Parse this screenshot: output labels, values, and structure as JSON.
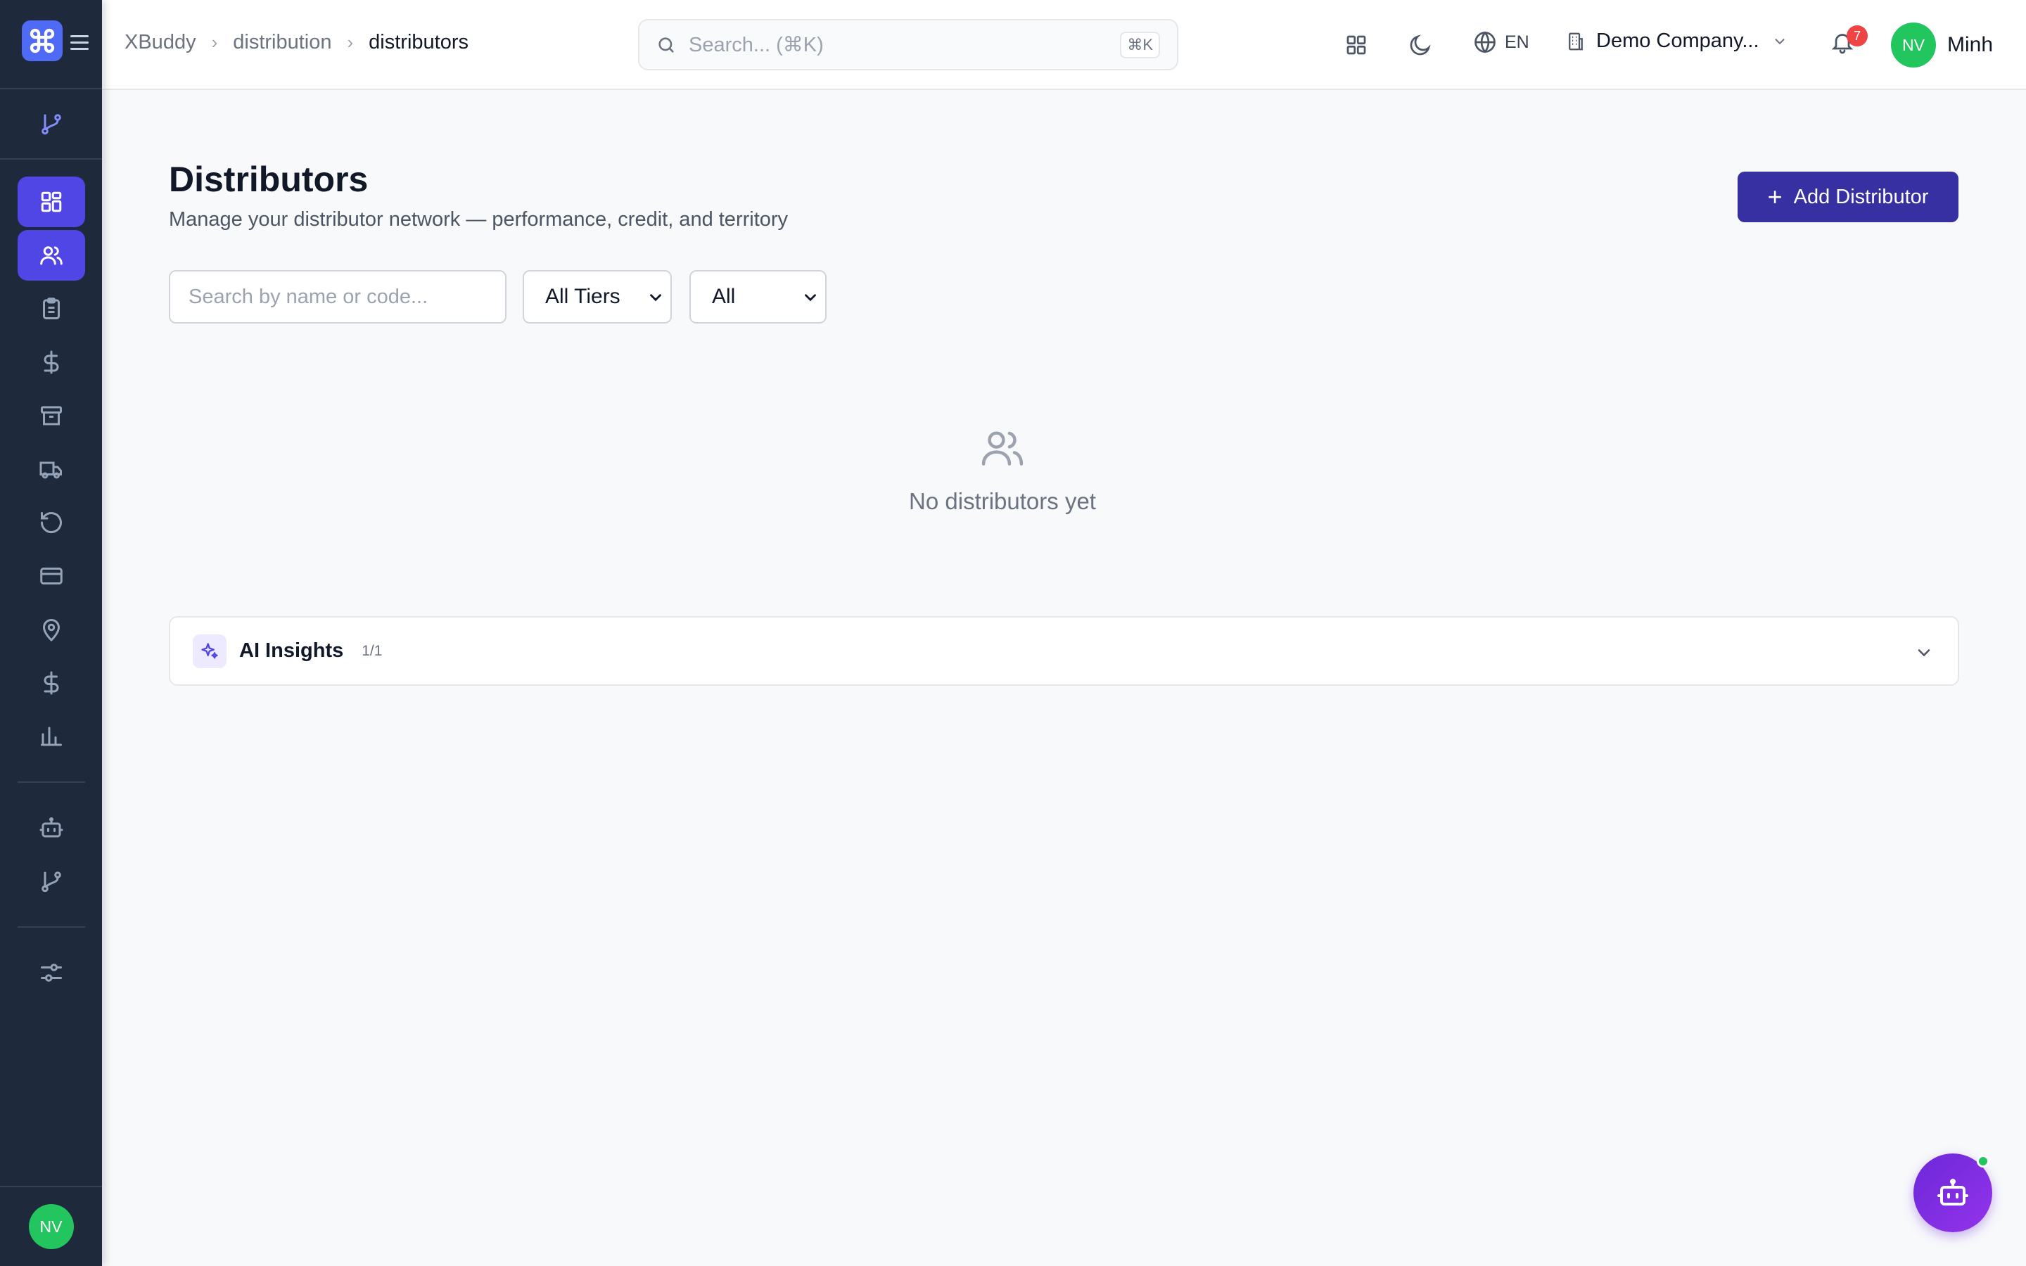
{
  "header": {
    "breadcrumb": [
      "XBuddy",
      "distribution",
      "distributors"
    ],
    "search_placeholder": "Search... (⌘K)",
    "search_shortcut": "⌘K",
    "language": "EN",
    "company": "Demo Company...",
    "notification_count": "7",
    "user_initials": "NV",
    "user_name": "Minh"
  },
  "sidebar": {
    "items": [
      {
        "icon": "dashboard-icon",
        "active": true
      },
      {
        "icon": "users-icon",
        "active": true
      },
      {
        "icon": "clipboard-icon",
        "active": false
      },
      {
        "icon": "dollar-icon",
        "active": false
      },
      {
        "icon": "archive-icon",
        "active": false
      },
      {
        "icon": "truck-icon",
        "active": false
      },
      {
        "icon": "refresh-icon",
        "active": false
      },
      {
        "icon": "credit-card-icon",
        "active": false
      },
      {
        "icon": "map-pin-icon",
        "active": false
      },
      {
        "icon": "dollar-icon",
        "active": false
      },
      {
        "icon": "bar-chart-icon",
        "active": false
      },
      {
        "icon": "bot-icon",
        "active": false
      },
      {
        "icon": "git-branch-icon",
        "active": false
      },
      {
        "icon": "sliders-icon",
        "active": false
      }
    ],
    "user_initials": "NV"
  },
  "page": {
    "title": "Distributors",
    "subtitle": "Manage your distributor network — performance, credit, and territory",
    "add_button": "Add Distributor",
    "search_placeholder": "Search by name or code...",
    "tier_filter": "All Tiers",
    "status_filter": "All",
    "empty_text": "No distributors yet"
  },
  "insights": {
    "label": "AI Insights",
    "count": "1/1"
  },
  "colors": {
    "sidebar_bg": "#1e293b",
    "accent": "#4f46e5",
    "primary_button": "#3730a3",
    "avatar": "#22c55e",
    "badge": "#ef4444"
  }
}
